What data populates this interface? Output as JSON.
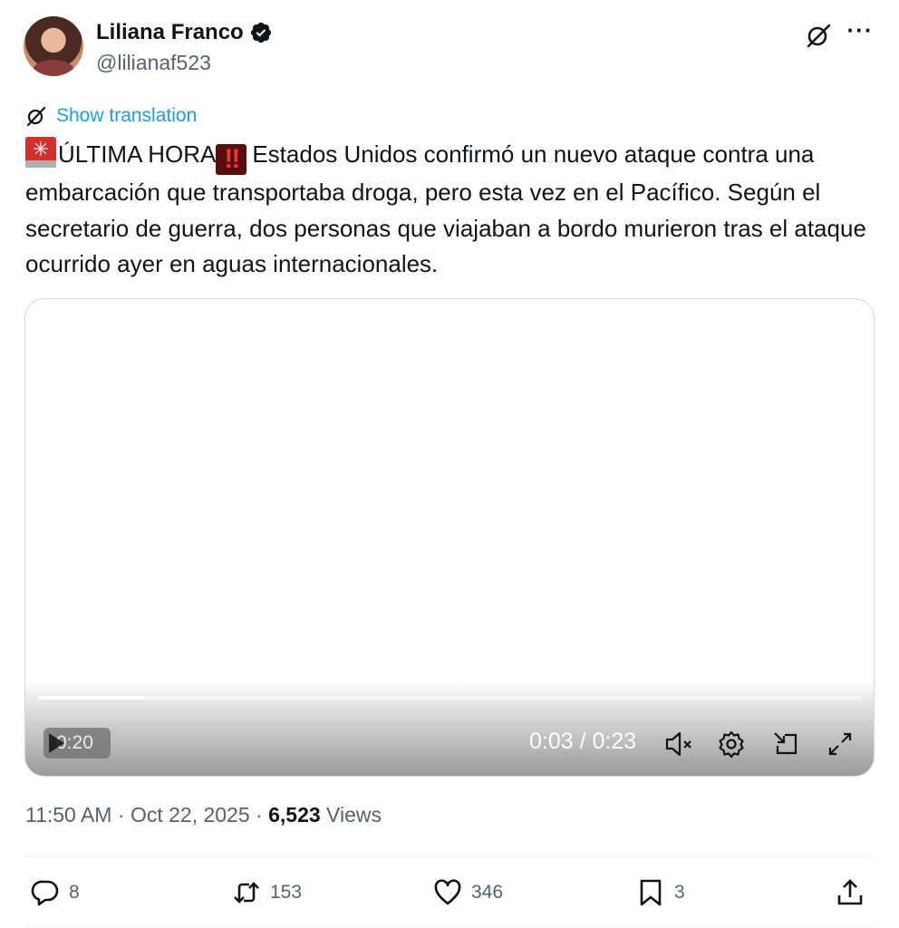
{
  "author": {
    "name": "Liliana Franco",
    "handle": "@lilianaf523",
    "verified": true
  },
  "translate": {
    "label": "Show translation"
  },
  "tweet": {
    "text_1": "ÚLTIMA HORA",
    "text_2": "Estados Unidos confirmó un nuevo ataque contra una embarcación que transportaba droga, pero esta vez en el Pacífico. Según el secretario de guerra, dos personas que viajaban a bordo murieron tras el ataque ocurrido ayer en aguas internacionales.",
    "emoji_1": "police-car-light",
    "emoji_2": "double-exclamation"
  },
  "video": {
    "remaining": "0:20",
    "timecode": "0:03 / 0:23",
    "progress_fraction": 0.13
  },
  "meta": {
    "time": "11:50 AM",
    "date": "Oct 22, 2025",
    "views_count": "6,523",
    "views_label": "Views"
  },
  "actions": {
    "replies": "8",
    "reposts": "153",
    "likes": "346",
    "bookmarks": "3"
  },
  "colors": {
    "link": "#1d9bf0",
    "secondary_text": "#536471",
    "primary_text": "#0f1419",
    "verified_badge": "#0f1419"
  }
}
